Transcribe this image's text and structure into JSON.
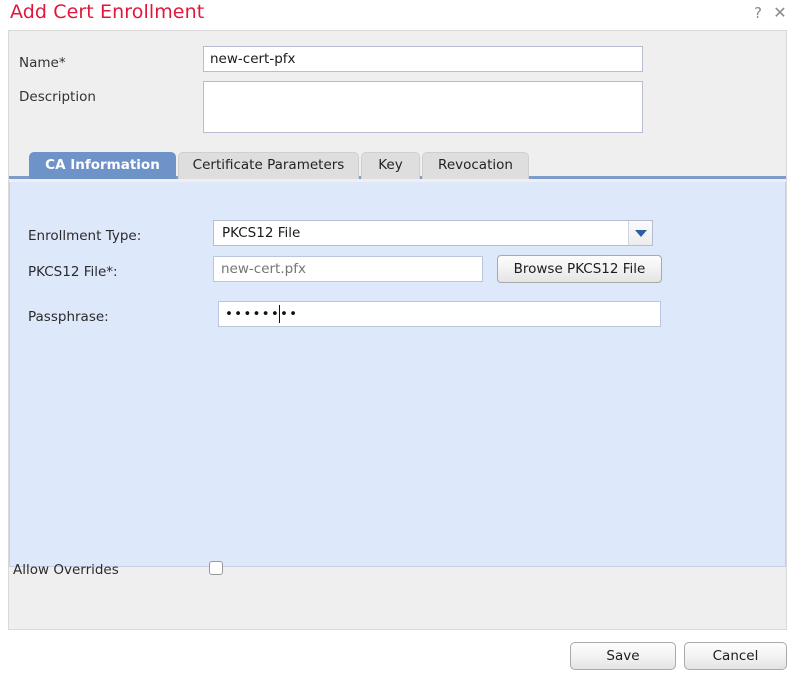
{
  "dialog": {
    "title": "Add Cert Enrollment",
    "help_icon": "question-mark-icon",
    "close_icon": "close-icon"
  },
  "header_fields": {
    "name": {
      "label": "Name*",
      "value": "new-cert-pfx",
      "placeholder": ""
    },
    "description": {
      "label": "Description",
      "value": "",
      "placeholder": ""
    }
  },
  "tabs": [
    {
      "label": "CA Information",
      "active": true
    },
    {
      "label": "Certificate Parameters",
      "active": false
    },
    {
      "label": "Key",
      "active": false
    },
    {
      "label": "Revocation",
      "active": false
    }
  ],
  "ca_information": {
    "enrollment_type": {
      "label": "Enrollment Type:",
      "selected": "PKCS12 File",
      "options": [
        "PKCS12 File"
      ]
    },
    "pkcs12_file": {
      "label": "PKCS12 File*:",
      "value": "",
      "placeholder": "new-cert.pfx",
      "browse_button_label": "Browse PKCS12 File"
    },
    "passphrase": {
      "label": "Passphrase:",
      "value": "••••••••",
      "placeholder": ""
    }
  },
  "allow_overrides": {
    "label": "Allow Overrides",
    "checked": false
  },
  "footer": {
    "save_label": "Save",
    "cancel_label": "Cancel"
  },
  "colors": {
    "title": "#e2163c",
    "panel_background": "#efefef",
    "tab_content_background": "#dde8fb",
    "active_tab": "#6e93c8",
    "tab_underline": "#7d9ccb"
  }
}
